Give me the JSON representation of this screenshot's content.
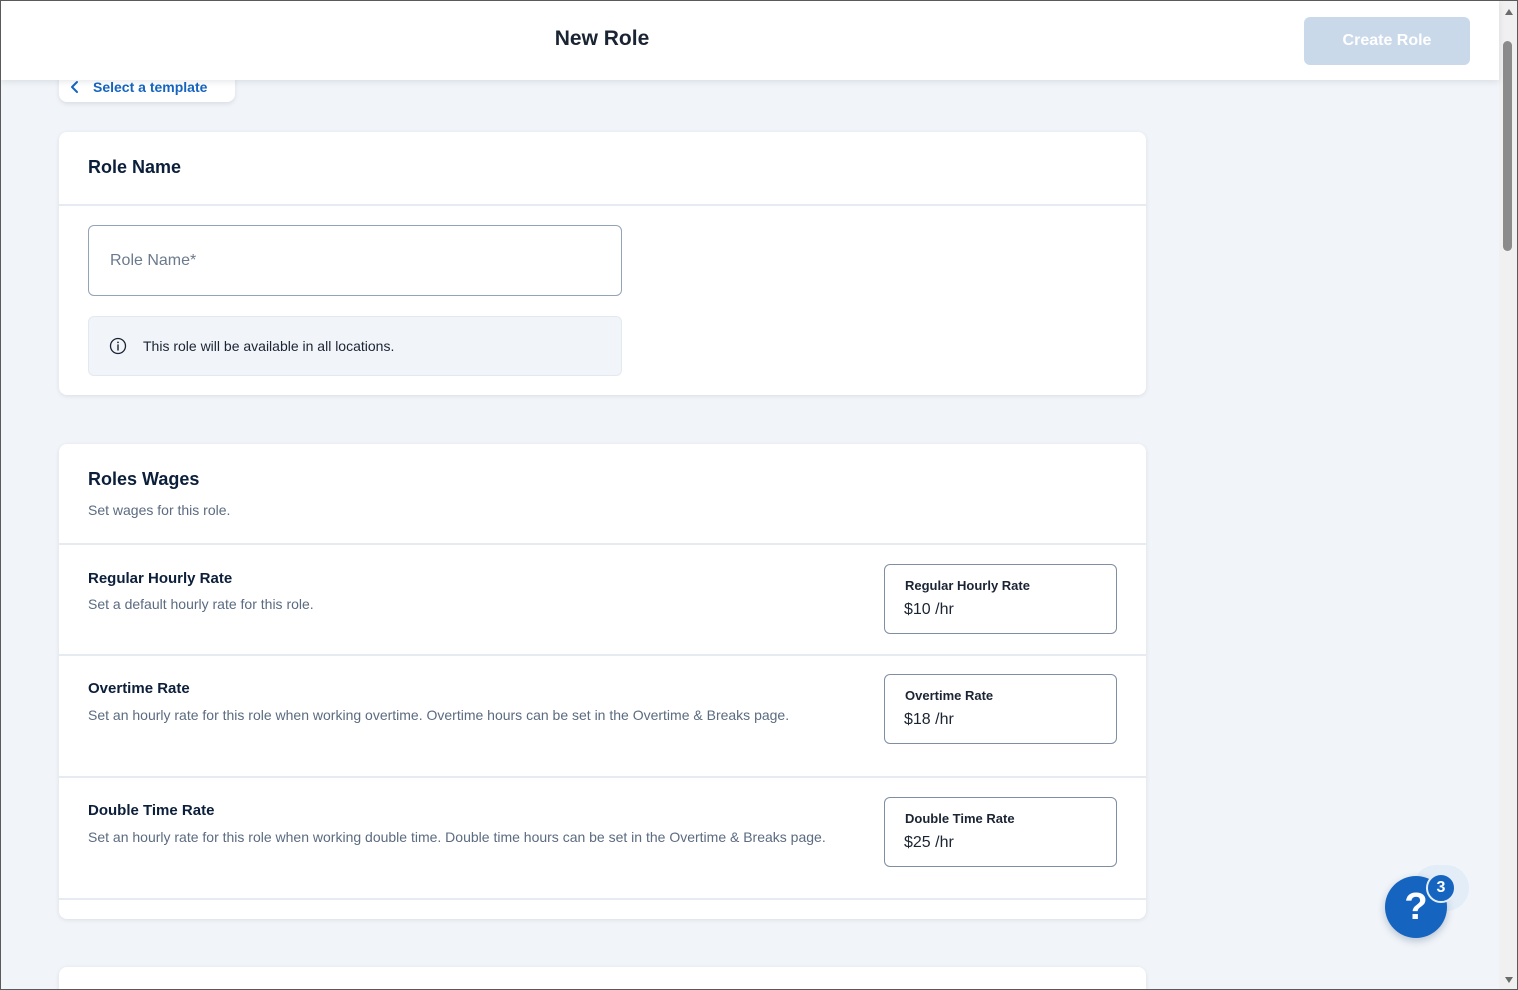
{
  "header": {
    "title": "New Role",
    "create_button_label": "Create Role"
  },
  "template_link": {
    "label": "Select a template",
    "icon": "chevron-left-icon"
  },
  "role_name_card": {
    "title": "Role Name",
    "input_placeholder": "Role Name*",
    "input_value": "",
    "info_icon": "info-icon",
    "info_text": "This role will be available in all locations."
  },
  "wages_card": {
    "title": "Roles Wages",
    "subtitle": "Set wages for this role.",
    "rates": [
      {
        "title": "Regular Hourly Rate",
        "description": "Set a default hourly rate for this role.",
        "field_label": "Regular Hourly Rate",
        "field_value": "$10 /hr"
      },
      {
        "title": "Overtime Rate",
        "description": "Set an hourly rate for this role when working overtime. Overtime hours can be set in the Overtime & Breaks page.",
        "field_label": "Overtime Rate",
        "field_value": "$18 /hr"
      },
      {
        "title": "Double Time Rate",
        "description": "Set an hourly rate for this role when working double time. Double time hours can be set in the Overtime & Breaks page.",
        "field_label": "Double Time Rate",
        "field_value": "$25 /hr"
      }
    ]
  },
  "help": {
    "icon": "question-mark-icon",
    "glyph": "?",
    "badge_count": "3"
  },
  "colors": {
    "accent": "#1565c0",
    "page_background": "#f1f5f9",
    "disabled_button": "#c9d9ea"
  }
}
